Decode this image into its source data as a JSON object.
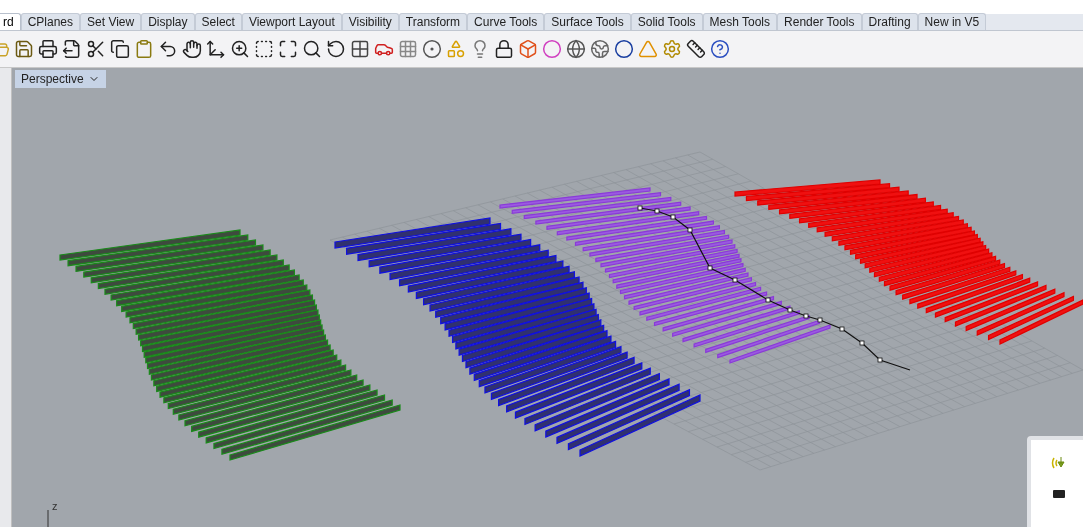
{
  "tabs": [
    {
      "label": "rd",
      "selected": true
    },
    {
      "label": "CPlanes",
      "selected": false
    },
    {
      "label": "Set View",
      "selected": false
    },
    {
      "label": "Display",
      "selected": false
    },
    {
      "label": "Select",
      "selected": false
    },
    {
      "label": "Viewport Layout",
      "selected": false
    },
    {
      "label": "Visibility",
      "selected": false
    },
    {
      "label": "Transform",
      "selected": false
    },
    {
      "label": "Curve Tools",
      "selected": false
    },
    {
      "label": "Surface Tools",
      "selected": false
    },
    {
      "label": "Solid Tools",
      "selected": false
    },
    {
      "label": "Mesh Tools",
      "selected": false
    },
    {
      "label": "Render Tools",
      "selected": false
    },
    {
      "label": "Drafting",
      "selected": false
    },
    {
      "label": "New in V5",
      "selected": false
    }
  ],
  "viewport": {
    "title": "Perspective",
    "axis_label": "z"
  }
}
